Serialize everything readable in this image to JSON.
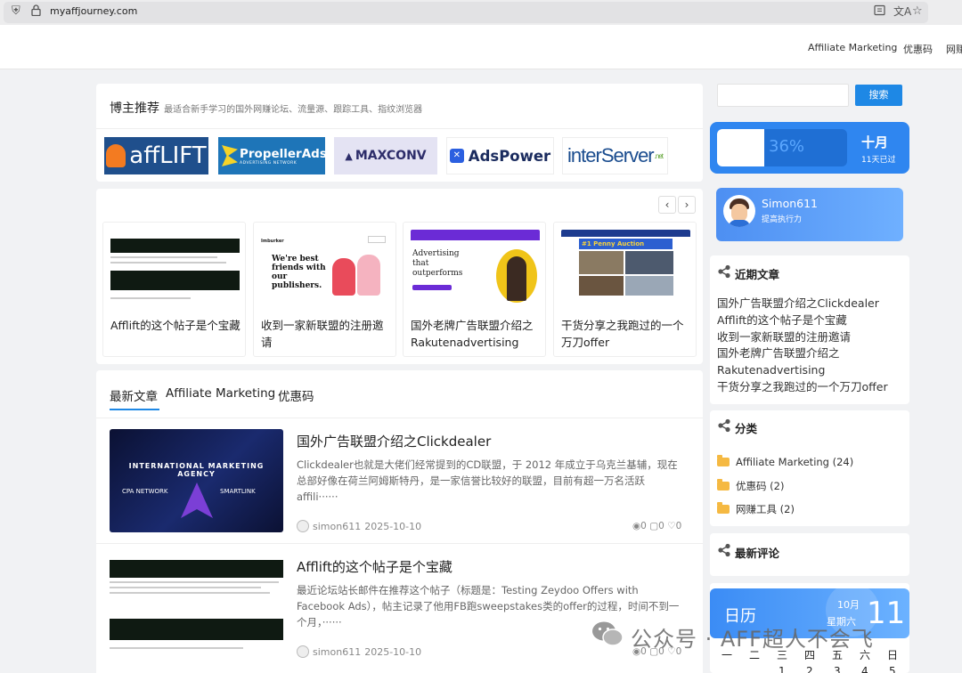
{
  "browser": {
    "url": "myaffjourney.com"
  },
  "nav": {
    "items": [
      "Affiliate Marketing",
      "优惠码",
      "网赚"
    ]
  },
  "featured": {
    "title": "博主推荐",
    "subtitle": "最适合新手学习的国外网赚论坛、流量源、跟踪工具、指纹浏览器",
    "logos": [
      "affLIFT",
      "PropellerAds",
      "ADVERTISING NETWORK",
      "MAXCONV",
      "AdsPower",
      "interServer",
      ".net"
    ]
  },
  "carousel": {
    "prev": "‹",
    "next": "›",
    "posts": [
      {
        "title": "Afflift的这个帖子是个宝藏"
      },
      {
        "title": "收到一家新联盟的注册邀请",
        "thumb_brand": "Imburker",
        "thumb_head": "We're best friends with our publishers."
      },
      {
        "title": "国外老牌广告联盟介绍之Rakutenadvertising",
        "thumb_head": "Advertising that outperforms"
      },
      {
        "title": "干货分享之我跑过的一个万刀offer",
        "thumb_head": "#1 Penny Auction"
      }
    ]
  },
  "tabs": [
    "最新文章",
    "Affiliate Marketing",
    "优惠码"
  ],
  "articles": [
    {
      "title": "国外广告联盟介绍之Clickdealer",
      "desc": "Clickdealer也就是大佬们经常提到的CD联盟，于 2012 年成立于乌克兰基辅，现在总部好像在荷兰阿姆斯特丹，是一家信誉比较好的联盟，目前有超一万名活跃affili······",
      "author": "simon611",
      "date": "2025-10-10",
      "views": "0",
      "comments": "0",
      "likes": "0",
      "thumb_line1": "INTERNATIONAL MARKETING",
      "thumb_line2": "AGENCY",
      "thumb_left": "CPA NETWORK",
      "thumb_right": "SMARTLINK"
    },
    {
      "title": "Afflift的这个帖子是个宝藏",
      "desc": "最近论坛站长邮件在推荐这个帖子（标题是：Testing Zeydoo Offers with Facebook Ads），帖主记录了他用FB跑sweepstakes类的offer的过程，时间不到一个月，······",
      "author": "simon611",
      "date": "2025-10-10",
      "views": "0",
      "comments": "0",
      "likes": "0"
    }
  ],
  "sidebar": {
    "search_placeholder": "",
    "search_button": "搜索",
    "progress": {
      "percent_label": "36%",
      "percent": 36,
      "month": "十月",
      "days_left": "11天已过"
    },
    "profile": {
      "name": "Simon611",
      "tagline": "提高执行力"
    },
    "recent_title": "近期文章",
    "recent": [
      "国外广告联盟介绍之Clickdealer",
      "Afflift的这个帖子是个宝藏",
      "收到一家新联盟的注册邀请",
      "国外老牌广告联盟介绍之Rakutenadvertising",
      "干货分享之我跑过的一个万刀offer"
    ],
    "categories_title": "分类",
    "categories": [
      "Affiliate Marketing (24)",
      "优惠码 (2)",
      "网赚工具 (2)"
    ],
    "comments_title": "最新评论",
    "calendar": {
      "label": "日历",
      "month": "10月",
      "weekday": "星期六",
      "day": "11",
      "weekdays": [
        "一",
        "二",
        "三",
        "四",
        "五",
        "六",
        "日"
      ],
      "first_row": [
        "1",
        "2",
        "3",
        "4",
        "5"
      ]
    }
  },
  "watermark": "公众号 · AFF超人不会飞"
}
